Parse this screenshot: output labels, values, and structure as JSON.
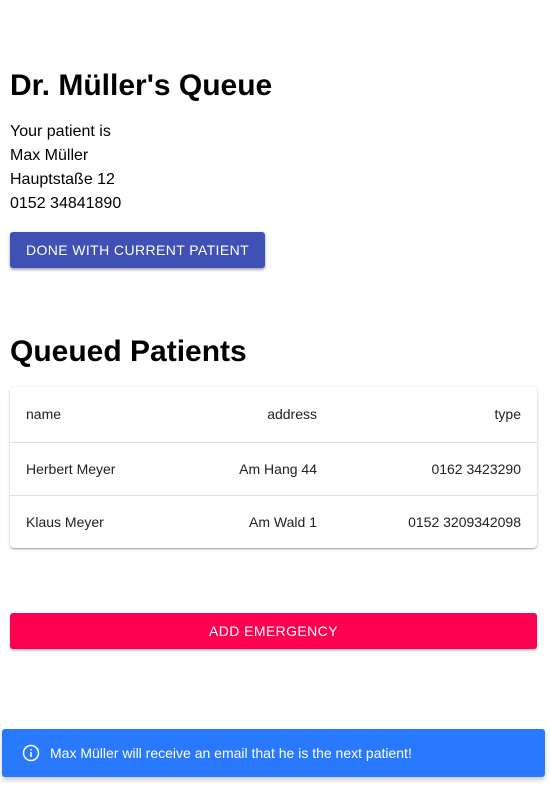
{
  "header": {
    "title": "Dr. Müller's Queue"
  },
  "current_patient": {
    "intro": "Your patient is",
    "name": "Max Müller",
    "address": "Hauptstaße 12",
    "phone": "0152 34841890"
  },
  "actions": {
    "done_label": "DONE WITH CURRENT PATIENT",
    "emergency_label": "ADD EMERGENCY"
  },
  "queue": {
    "title": "Queued Patients",
    "columns": [
      "name",
      "address",
      "type"
    ],
    "rows": [
      {
        "name": "Herbert Meyer",
        "address": "Am Hang 44",
        "type": "0162 3423290"
      },
      {
        "name": "Klaus Meyer",
        "address": "Am Wald 1",
        "type": "0152 3209342098"
      }
    ]
  },
  "notification": {
    "icon": "info-icon",
    "message": "Max Müller will receive an email that he is the next patient!"
  },
  "colors": {
    "primary": "#3f51b5",
    "secondary": "#ff0050",
    "info": "#2979ff"
  }
}
